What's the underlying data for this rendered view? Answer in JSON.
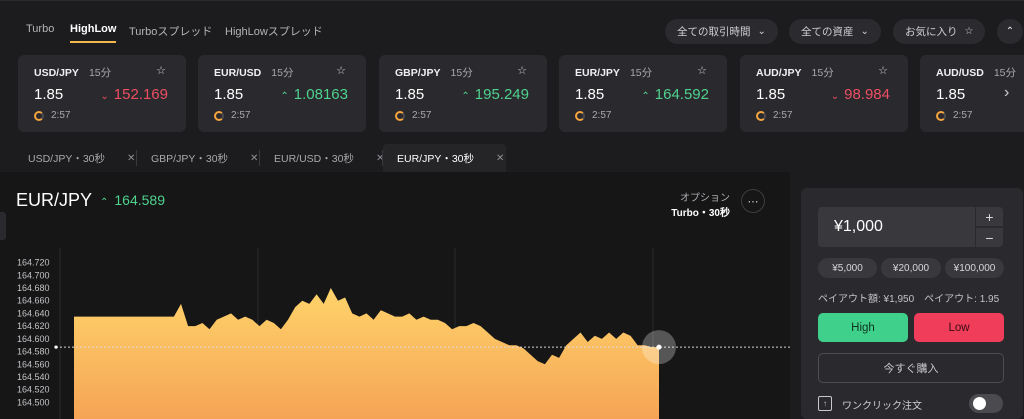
{
  "modes": [
    "Turbo",
    "HighLow",
    "Turboスプレッド",
    "HighLowスプレッド"
  ],
  "active_mode": "HighLow",
  "filters": {
    "time": "全ての取引時間",
    "assets": "全ての資産",
    "favorites": "お気に入り"
  },
  "icons": {
    "dropdown": "chevron-down-icon",
    "star": "star-icon",
    "collapse": "chevron-up-icon",
    "close": "close-icon",
    "next": "chevron-right-icon",
    "more": "more-icon",
    "timer": "timer-ring-icon",
    "oneclick": "one-click-icon"
  },
  "cards": [
    {
      "symbol": "USD/JPY",
      "period": "15分",
      "payout": "1.85",
      "direction": "down",
      "quote": "152.169",
      "timer": "2:57"
    },
    {
      "symbol": "EUR/USD",
      "period": "15分",
      "payout": "1.85",
      "direction": "up",
      "quote": "1.08163",
      "timer": "2:57"
    },
    {
      "symbol": "GBP/JPY",
      "period": "15分",
      "payout": "1.85",
      "direction": "up",
      "quote": "195.249",
      "timer": "2:57"
    },
    {
      "symbol": "EUR/JPY",
      "period": "15分",
      "payout": "1.85",
      "direction": "up",
      "quote": "164.592",
      "timer": "2:57"
    },
    {
      "symbol": "AUD/JPY",
      "period": "15分",
      "payout": "1.85",
      "direction": "down",
      "quote": "98.984",
      "timer": "2:57"
    },
    {
      "symbol": "AUD/USD",
      "period": "15分",
      "payout": "1.85",
      "direction": "",
      "quote": "",
      "timer": "2:57"
    }
  ],
  "chart_tabs": [
    "USD/JPY・30秒",
    "GBP/JPY・30秒",
    "EUR/USD・30秒",
    "EUR/JPY・30秒"
  ],
  "active_chart_tab": 3,
  "main": {
    "pair": "EUR/JPY",
    "direction": "up",
    "quote": "164.589",
    "option_label": "オプション",
    "option_value": "Turbo・30秒"
  },
  "colors": {
    "up": "#4fd28e",
    "down": "#ee4e62",
    "high_button": "#3fd18b",
    "low_button": "#f03e5a",
    "area_top": "#ffd36b",
    "area_bottom": "#f5a455",
    "timer_ring": "#f5a53d"
  },
  "chart_data": {
    "type": "area",
    "y_ticks": [
      "164.720",
      "164.700",
      "164.680",
      "164.660",
      "164.640",
      "164.620",
      "164.600",
      "164.580",
      "164.560",
      "164.540",
      "164.520",
      "164.500"
    ],
    "ylim": [
      164.496,
      164.724
    ],
    "current_price": 164.587,
    "grid": "vertical",
    "y": [
      164.635,
      164.635,
      164.635,
      164.635,
      164.635,
      164.635,
      164.635,
      164.635,
      164.635,
      164.635,
      164.635,
      164.635,
      164.635,
      164.635,
      164.635,
      164.655,
      164.62,
      164.62,
      164.625,
      164.615,
      164.63,
      164.635,
      164.64,
      164.63,
      164.635,
      164.63,
      164.62,
      164.63,
      164.625,
      164.615,
      164.63,
      164.65,
      164.66,
      164.655,
      164.67,
      164.655,
      164.68,
      164.66,
      164.665,
      164.64,
      164.635,
      164.64,
      164.63,
      164.645,
      164.64,
      164.635,
      164.635,
      164.64,
      164.63,
      164.635,
      164.63,
      164.63,
      164.625,
      164.615,
      164.62,
      164.62,
      164.625,
      164.62,
      164.61,
      164.6,
      164.595,
      164.59,
      164.59,
      164.585,
      164.575,
      164.565,
      164.56,
      164.575,
      164.57,
      164.59,
      164.6,
      164.61,
      164.595,
      164.605,
      164.6,
      164.61,
      164.6,
      164.61,
      164.605,
      164.59,
      164.59,
      164.587,
      164.587
    ]
  },
  "trade": {
    "amount": "¥1,000",
    "plus": "+",
    "minus": "−",
    "presets": [
      "¥5,000",
      "¥20,000",
      "¥100,000"
    ],
    "payout_amount": "ペイアウト額: ¥1,950",
    "payout_rate": "ペイアウト: 1.95",
    "high": "High",
    "low": "Low",
    "buy_now": "今すぐ購入",
    "one_click": "ワンクリック注文",
    "one_click_enabled": false
  }
}
